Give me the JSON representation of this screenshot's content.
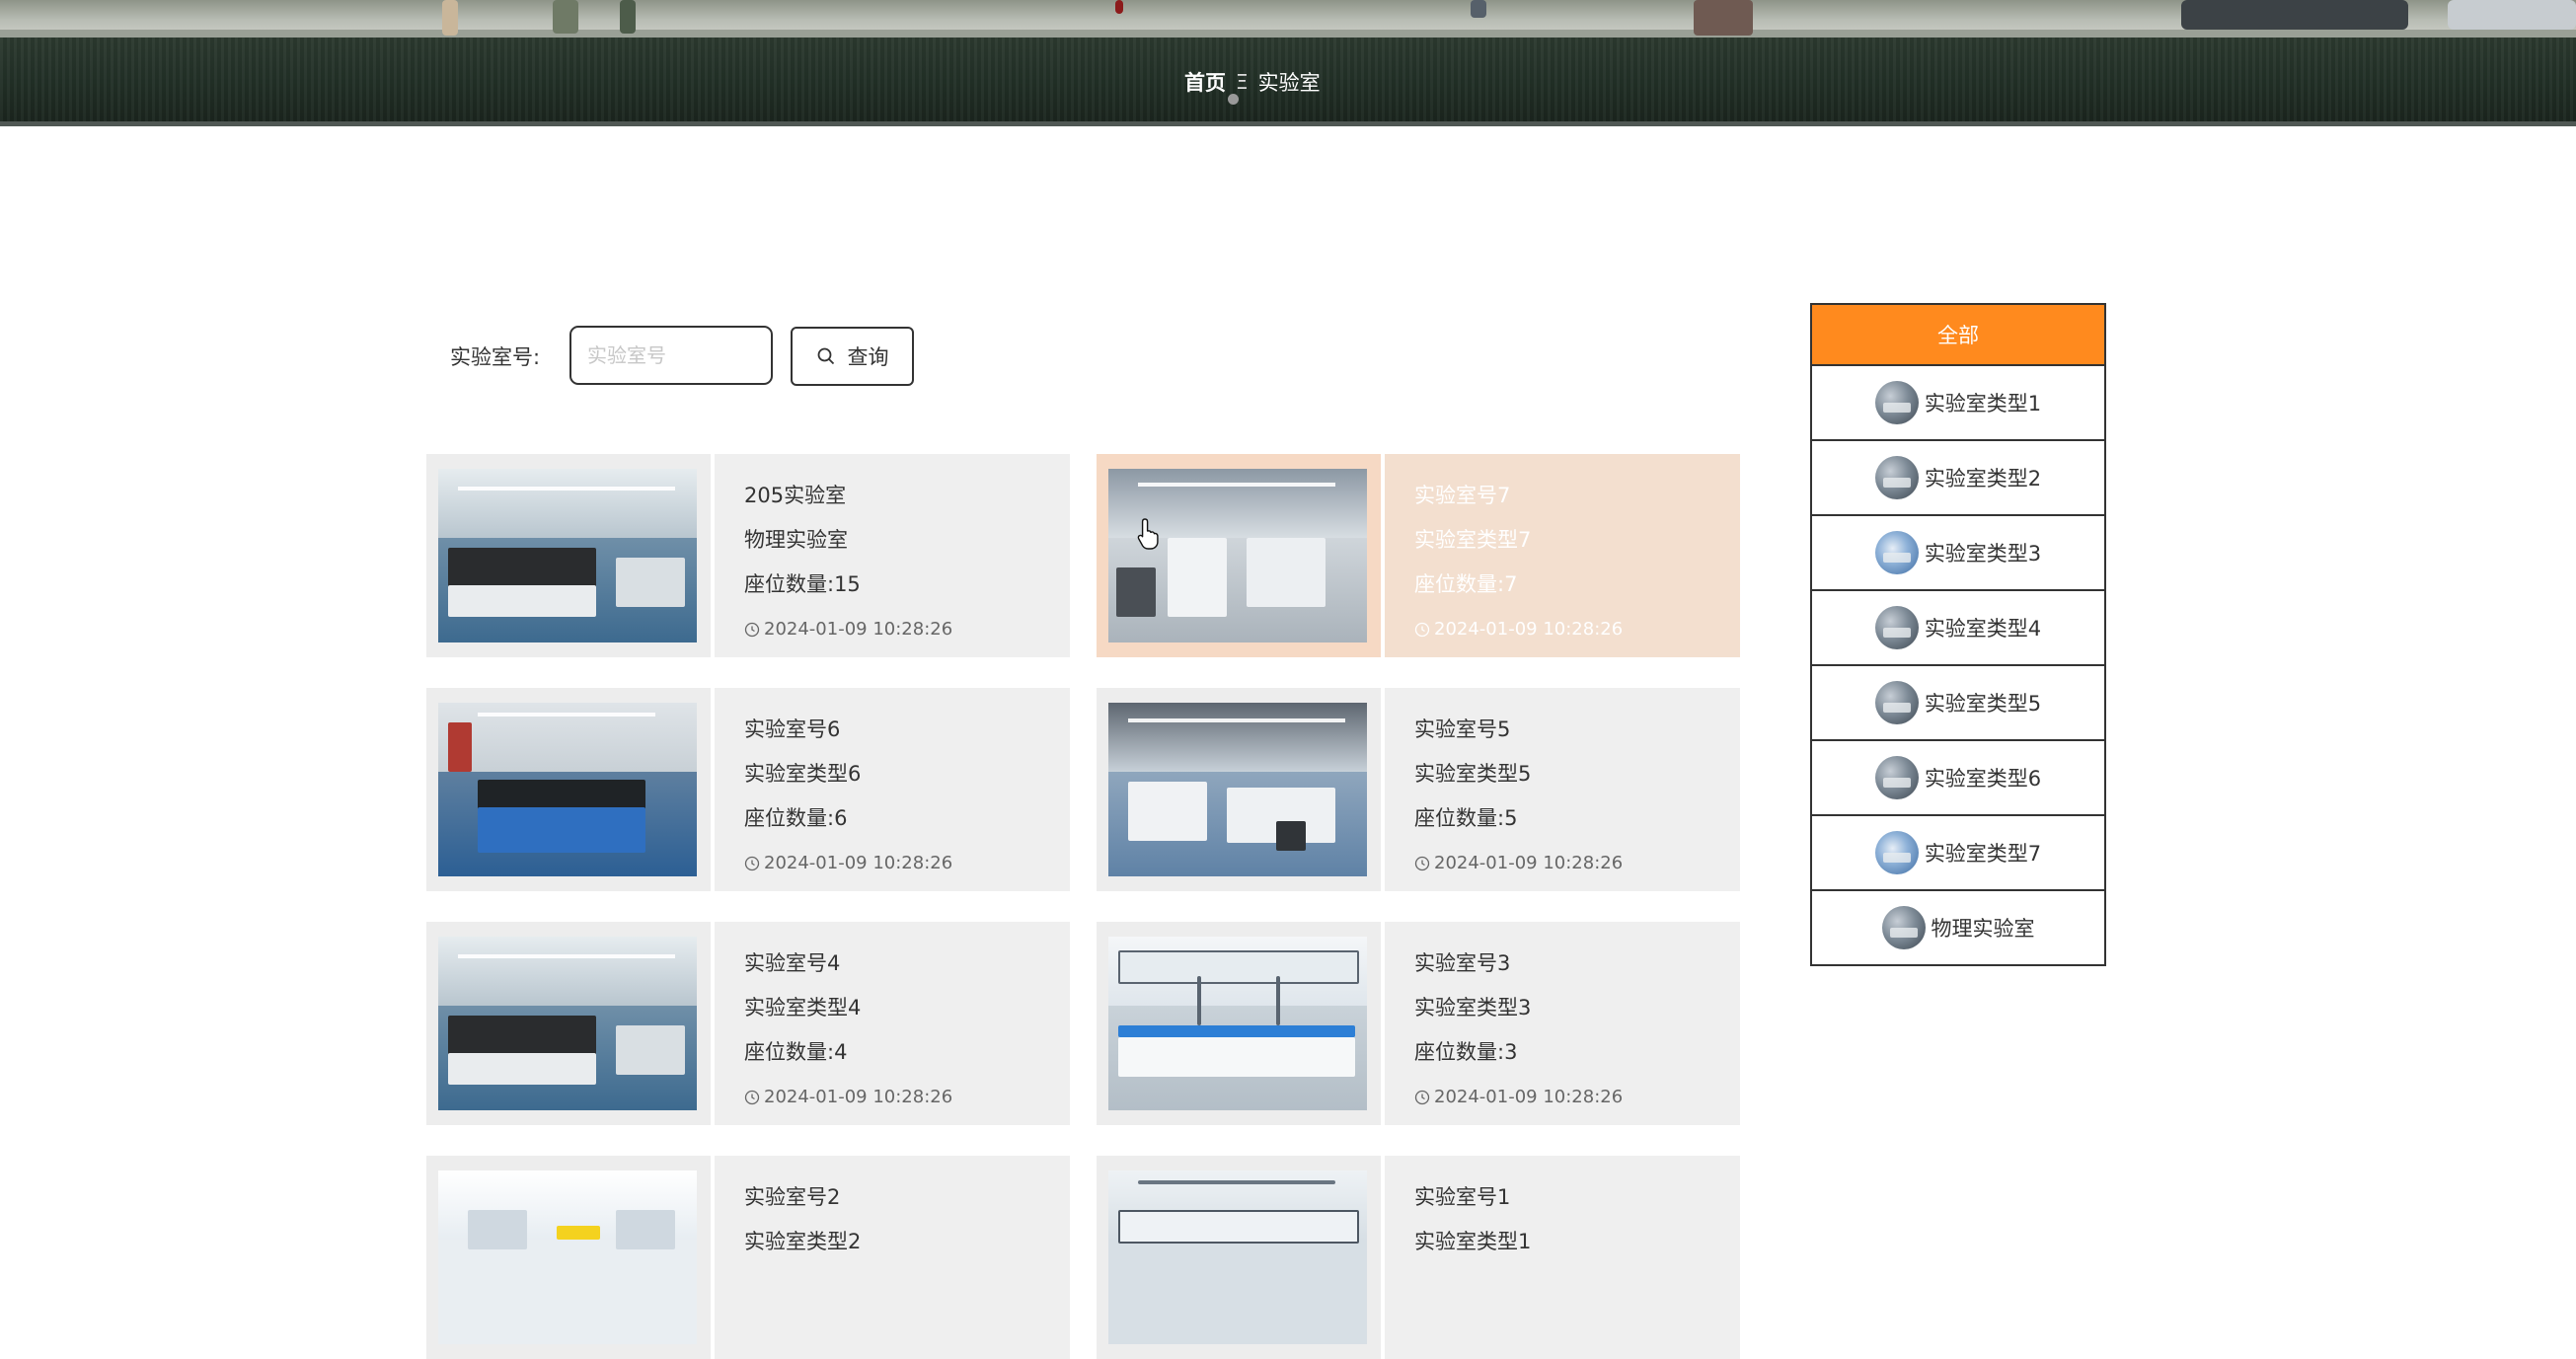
{
  "breadcrumb": {
    "home": "首页",
    "separator": "Ξ",
    "current": "实验室"
  },
  "search": {
    "label": "实验室号:",
    "placeholder": "实验室号",
    "value": "",
    "button_label": "查询",
    "button_icon": "search-icon"
  },
  "labs": [
    {
      "name": "205实验室",
      "type": "物理实验室",
      "seats": "座位数量:15",
      "time": "2024-01-09 10:28:26",
      "photo": "lab-photo-blue-floor"
    },
    {
      "name": "实验室号7",
      "type": "实验室类型7",
      "seats": "座位数量:7",
      "time": "2024-01-09 10:28:26",
      "photo": "lab-photo-white-room",
      "state": "hovered"
    },
    {
      "name": "实验室号6",
      "type": "实验室类型6",
      "seats": "座位数量:6",
      "time": "2024-01-09 10:28:26",
      "photo": "lab-photo-blue-cabinets"
    },
    {
      "name": "实验室号5",
      "type": "实验室类型5",
      "seats": "座位数量:5",
      "time": "2024-01-09 10:28:26",
      "photo": "lab-photo-white-benches"
    },
    {
      "name": "实验室号4",
      "type": "实验室类型4",
      "seats": "座位数量:4",
      "time": "2024-01-09 10:28:26",
      "photo": "lab-photo-blue-floor"
    },
    {
      "name": "实验室号3",
      "type": "实验室类型3",
      "seats": "座位数量:3",
      "time": "2024-01-09 10:28:26",
      "photo": "lab-photo-blue-shelves"
    },
    {
      "name": "实验室号2",
      "type": "实验室类型2",
      "seats": "",
      "time": "",
      "photo": "lab-photo-bright"
    },
    {
      "name": "实验室号1",
      "type": "实验室类型1",
      "seats": "",
      "time": "",
      "photo": "lab-photo-shelves"
    }
  ],
  "categories": {
    "all_label": "全部",
    "items": [
      {
        "label": "实验室类型1"
      },
      {
        "label": "实验室类型2"
      },
      {
        "label": "实验室类型3"
      },
      {
        "label": "实验室类型4"
      },
      {
        "label": "实验室类型5"
      },
      {
        "label": "实验室类型6"
      },
      {
        "label": "实验室类型7"
      },
      {
        "label": "物理实验室"
      }
    ]
  },
  "colors": {
    "accent": "#ff8a1e",
    "card_bg": "#efefef",
    "card_hover_bg": "#f3dfcf"
  }
}
